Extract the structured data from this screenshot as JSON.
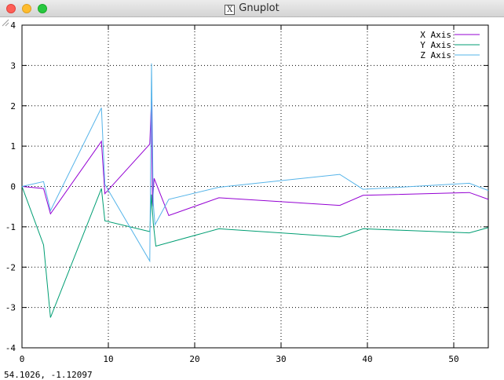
{
  "window": {
    "title": "Gnuplot",
    "app_icon": "x11-icon",
    "buttons": [
      "close",
      "minimize",
      "maximize"
    ]
  },
  "status_readout": "54.1026, -1.12097",
  "chart_data": {
    "type": "line",
    "title": "",
    "xlabel": "",
    "ylabel": "",
    "xlim": [
      0,
      54
    ],
    "ylim": [
      -4,
      4
    ],
    "xticks": [
      0,
      10,
      20,
      30,
      40,
      50
    ],
    "yticks": [
      -4,
      -3,
      -2,
      -1,
      0,
      1,
      2,
      3,
      4
    ],
    "grid": "dotted",
    "legend": "top-right",
    "series": [
      {
        "name": "X Axis",
        "color": "#9400d3",
        "x": [
          0,
          2.5,
          3.3,
          9.2,
          9.6,
          14.8,
          15.0,
          15.1,
          15.3,
          17.0,
          22.8,
          36.8,
          39.5,
          51.8,
          54
        ],
        "y": [
          0,
          -0.05,
          -0.68,
          1.12,
          -0.18,
          1.05,
          2.2,
          -0.5,
          0.2,
          -0.72,
          -0.28,
          -0.47,
          -0.22,
          -0.15,
          -0.32
        ]
      },
      {
        "name": "Y Axis",
        "color": "#009e73",
        "x": [
          0,
          2.5,
          3.3,
          9.2,
          9.6,
          14.8,
          15.0,
          15.2,
          15.5,
          22.8,
          36.8,
          39.5,
          51.8,
          54
        ],
        "y": [
          0,
          -1.45,
          -3.25,
          -0.05,
          -0.85,
          -1.12,
          -0.2,
          -0.9,
          -1.48,
          -1.05,
          -1.25,
          -1.05,
          -1.15,
          -1.02
        ]
      },
      {
        "name": "Z Axis",
        "color": "#56b4e9",
        "x": [
          0,
          2.5,
          3.3,
          9.2,
          9.6,
          14.8,
          15.0,
          15.2,
          15.4,
          17.0,
          22.8,
          36.8,
          39.5,
          51.8,
          54
        ],
        "y": [
          0,
          0.12,
          -0.6,
          1.95,
          0.05,
          -1.85,
          3.05,
          -0.4,
          -0.95,
          -0.32,
          -0.02,
          0.3,
          -0.07,
          0.08,
          -0.1
        ]
      }
    ]
  }
}
